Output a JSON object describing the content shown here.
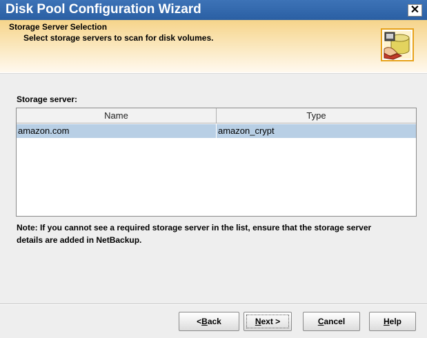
{
  "window": {
    "title": "Disk Pool Configuration Wizard",
    "close_glyph": "✕"
  },
  "banner": {
    "title": "Storage Server Selection",
    "subtitle": "Select storage servers to scan for disk volumes.",
    "icon": "disk-storage-icon"
  },
  "storage": {
    "label": "Storage server:",
    "columns": [
      "Name",
      "Type"
    ],
    "rows": [
      {
        "name": "amazon.com",
        "type": "amazon_crypt",
        "selected": true
      }
    ]
  },
  "note": "Note: If you cannot see a required storage server in the list, ensure that the storage server details are added in NetBackup.",
  "buttons": {
    "back": {
      "pre": "< ",
      "mnemonic": "B",
      "post": "ack"
    },
    "next": {
      "pre": "",
      "mnemonic": "N",
      "post": "ext >"
    },
    "cancel": {
      "pre": "",
      "mnemonic": "C",
      "post": "ancel"
    },
    "help": {
      "pre": "",
      "mnemonic": "H",
      "post": "elp"
    }
  },
  "colors": {
    "titlebar": "#2a5fa3",
    "banner": "#f6d48a",
    "selected_row": "#b8cfe5"
  }
}
